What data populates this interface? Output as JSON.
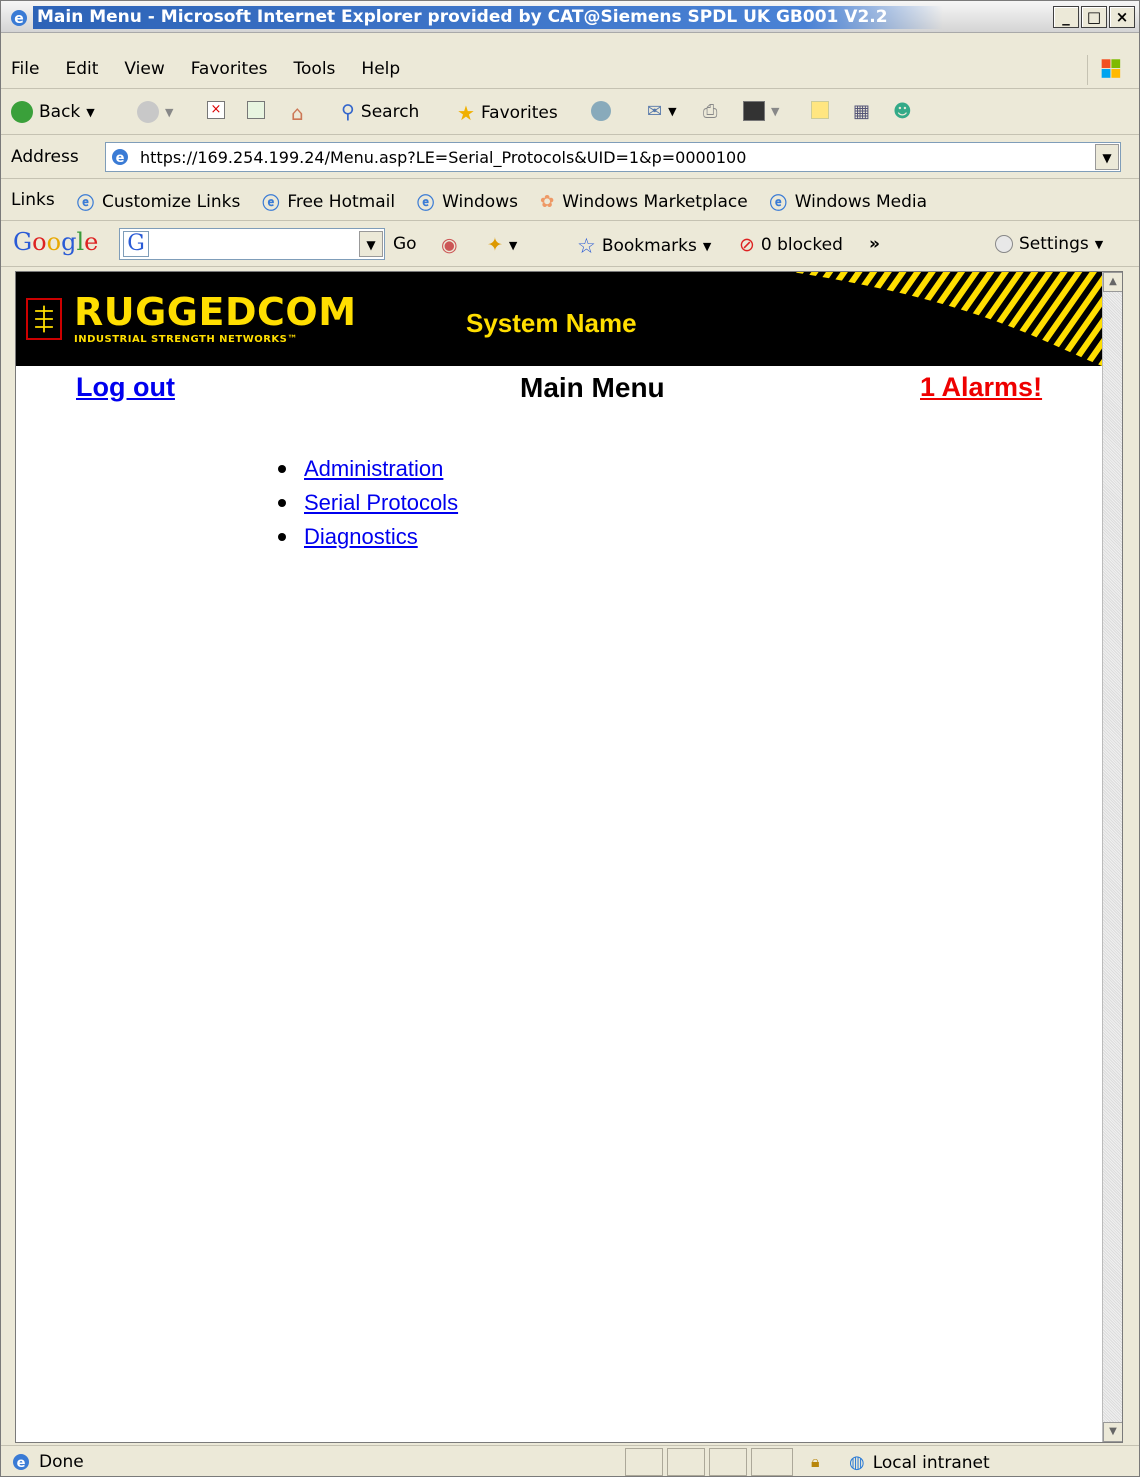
{
  "window": {
    "title": "Main Menu - Microsoft Internet Explorer provided by CAT@Siemens SPDL UK GB001 V2.2"
  },
  "menubar": {
    "items": [
      "File",
      "Edit",
      "View",
      "Favorites",
      "Tools",
      "Help"
    ]
  },
  "toolbar": {
    "back": "Back",
    "search": "Search",
    "favorites": "Favorites"
  },
  "address": {
    "label": "Address",
    "url": "https://169.254.199.24/Menu.asp?LE=Serial_Protocols&UID=1&p=0000100"
  },
  "links": {
    "label": "Links",
    "items": [
      "Customize Links",
      "Free Hotmail",
      "Windows",
      "Windows Marketplace",
      "Windows Media"
    ]
  },
  "googlebar": {
    "logo": "Google",
    "go": "Go",
    "bookmarks": "Bookmarks",
    "blocked": "0 blocked",
    "settings": "Settings"
  },
  "banner": {
    "brand": "RUGGEDCOM",
    "tagline": "INDUSTRIAL STRENGTH NETWORKS™",
    "system_name": "System Name"
  },
  "page": {
    "logout": "Log out",
    "title": "Main Menu",
    "alarms": "1 Alarms!",
    "menu": [
      "Administration",
      "Serial Protocols",
      "Diagnostics"
    ]
  },
  "status": {
    "text": "Done",
    "zone": "Local intranet"
  },
  "colors": {
    "banner_bg": "#000000",
    "brand_yellow": "#ffde00",
    "link": "#0000ee",
    "alarm": "#ee0000"
  }
}
